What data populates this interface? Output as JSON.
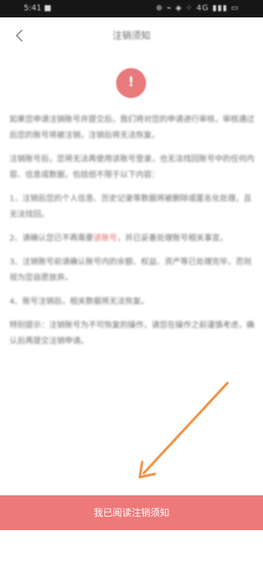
{
  "status_bar": {
    "left": "5:41 ■",
    "right": "⊕ ⌁ ◈ ⁘ 4G ▮▮▮ ▭"
  },
  "header": {
    "title": "注销须知"
  },
  "alert_icon": {
    "glyph": "!",
    "color": "#e97a7c"
  },
  "content": {
    "paragraphs": [
      "如果您申请注销账号并提交后，我们将对您的申请进行审核，审核通过后您的账号将被注销，注销后将无法恢复。",
      "注销账号后，您将无法再使用该账号登录，也无法找回账号中的任何内容、信息或数据，包括但不限于以下内容：",
      "1、注销后您的个人信息、历史记录等数据将被删除或匿名化处理，且无法找回。",
      "2、请确认您已不再需要该账号，并已妥善处理账号相关事宜。",
      "3、注销账号前请确认账号内的余额、权益、资产等已处理完毕，否则视为您自愿放弃。",
      "4、账号注销后，相关数据将无法恢复。",
      "特别提示：注销账号为不可恢复的操作，请您在操作之前谨慎考虑，确认后再提交注销申请。"
    ],
    "highlight_prefix": "2、请确认您已不再需要",
    "highlight_text": "该账号",
    "highlight_suffix": "，并已妥善处理账号相关事宜。"
  },
  "footer": {
    "button_label": "我已阅读注销须知",
    "button_color": "#ee7979"
  },
  "annotation": {
    "arrow_color": "#f0954b"
  }
}
